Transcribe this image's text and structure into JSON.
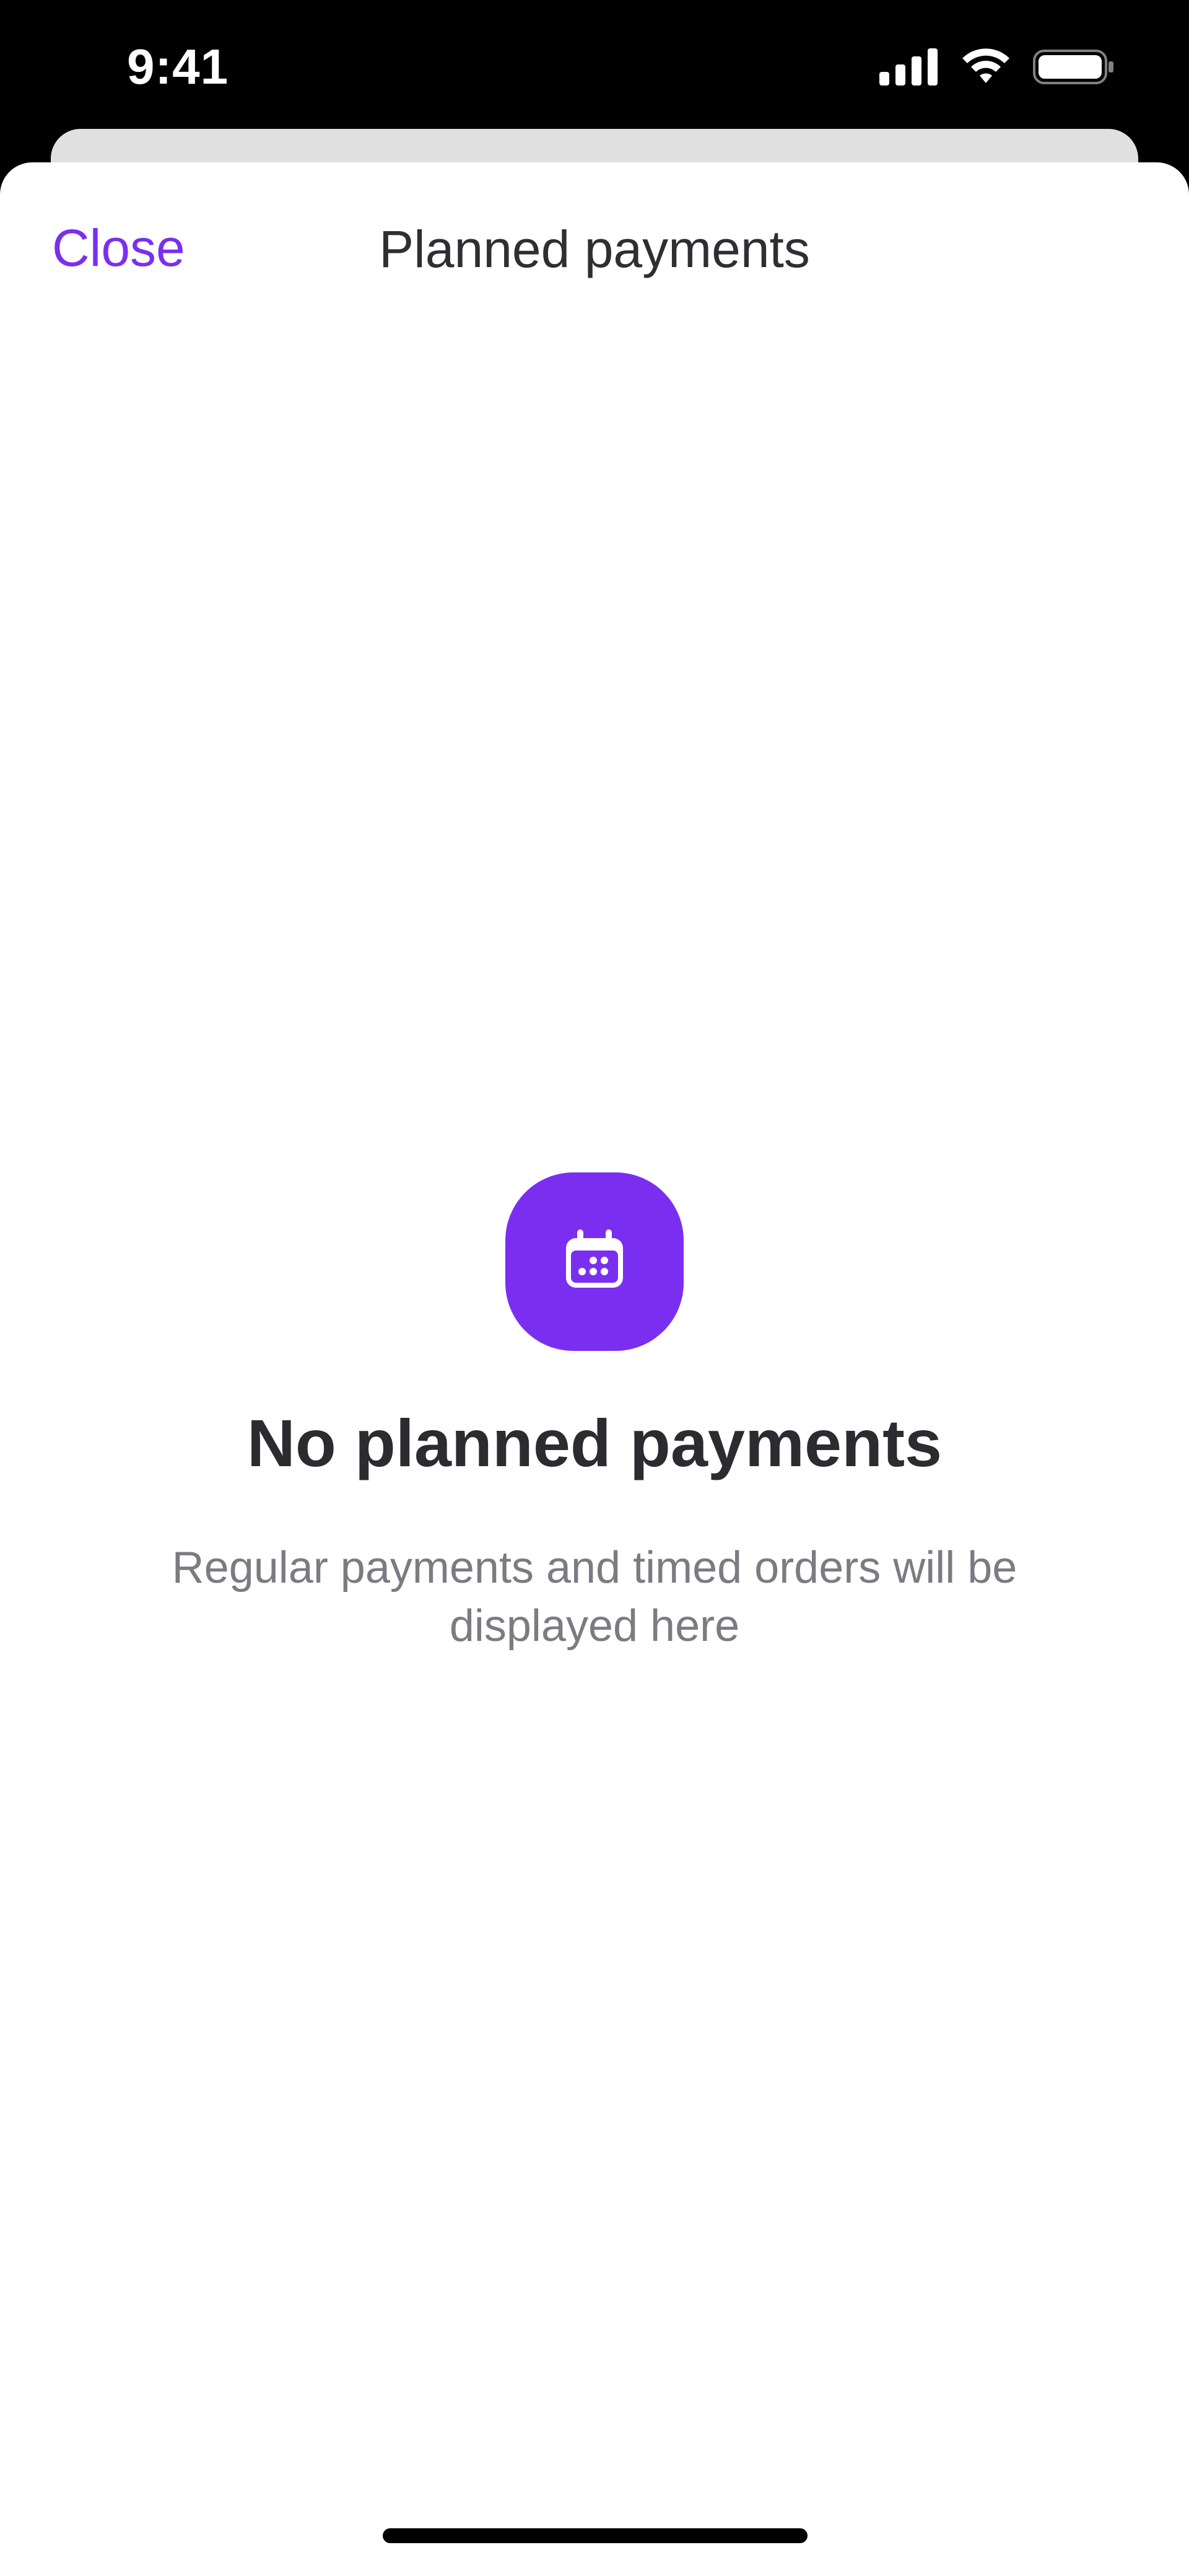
{
  "status_bar": {
    "time": "9:41",
    "icons": [
      "signal-icon",
      "wifi-icon",
      "battery-icon"
    ]
  },
  "header": {
    "close_label": "Close",
    "title": "Planned payments"
  },
  "empty_state": {
    "icon": "calendar-icon",
    "title": "No planned payments",
    "subtitle": "Regular payments and timed orders will be displayed here"
  },
  "colors": {
    "accent": "#7a2ff0",
    "title_text": "#2b2b30",
    "secondary_text": "#7b7b82",
    "background": "#ffffff",
    "status_bar": "#000000"
  }
}
